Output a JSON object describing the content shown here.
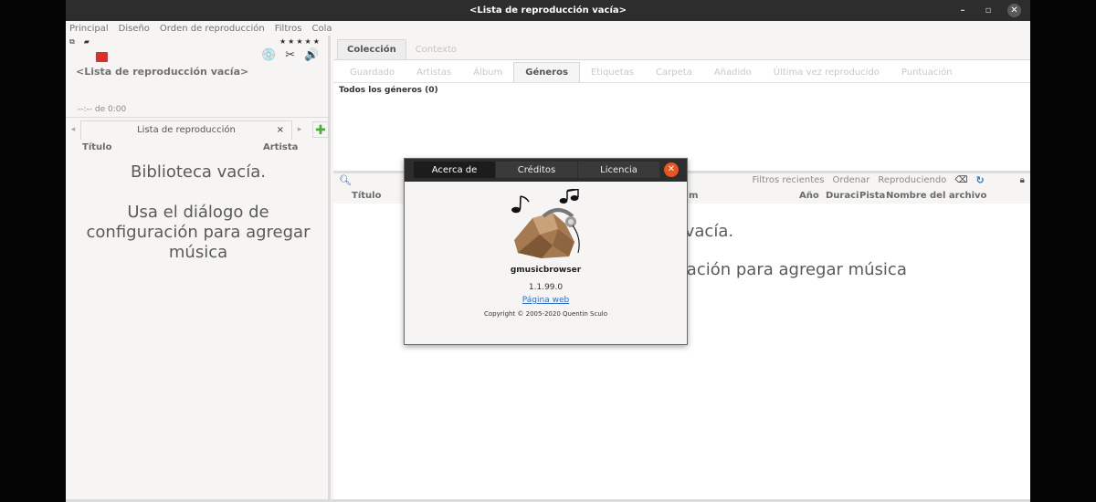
{
  "window": {
    "title": "<Lista de reproducción vacía>",
    "minimize": "–",
    "maximize": "▫",
    "close": "✕"
  },
  "menu": [
    "Principal",
    "Diseño",
    "Orden de reproducción",
    "Filtros",
    "Cola"
  ],
  "player": {
    "now_playing": "<Lista de reproducción vacía>",
    "time": "--:-- de 0:00",
    "stars": "★★★★★"
  },
  "playlist": {
    "tab_label": "Lista de reproducción",
    "prev_arrow": "◂",
    "next_arrow": "▸",
    "close": "×",
    "add": "✚",
    "columns": [
      "Título",
      "Artista"
    ],
    "empty_lines": [
      "Biblioteca vacía.",
      "",
      "Usa el diálogo de",
      "configuración para agregar",
      "música"
    ]
  },
  "collection": {
    "tabs": [
      "Colección",
      "Contexto"
    ],
    "subtabs": [
      "Guardado",
      "Artistas",
      "Álbum",
      "Géneros",
      "Etiquetas",
      "Carpeta",
      "Añadido",
      "Última vez reproducido",
      "Puntuación"
    ],
    "active_subtab": "Géneros",
    "all_genres": "Todos los géneros (0)"
  },
  "filter_bar": {
    "buttons": [
      "Filtros recientes",
      "Ordenar",
      "Reproduciendo"
    ]
  },
  "library": {
    "columns": {
      "title": "Título",
      "album_fragment": "m",
      "year": "Año",
      "duration": "Duraci",
      "track": "Pista",
      "filename": "Nombre del archivo"
    },
    "empty_line1": "a vacía.",
    "empty_line2": "uración para agregar música"
  },
  "about": {
    "tabs": [
      "Acerca de",
      "Créditos",
      "Licencia"
    ],
    "close": "✕",
    "name": "gmusicbrowser",
    "version": "1.1.99.0",
    "link": "Página web",
    "copyright": "Copyright © 2005-2020 Quentin Sculo"
  }
}
